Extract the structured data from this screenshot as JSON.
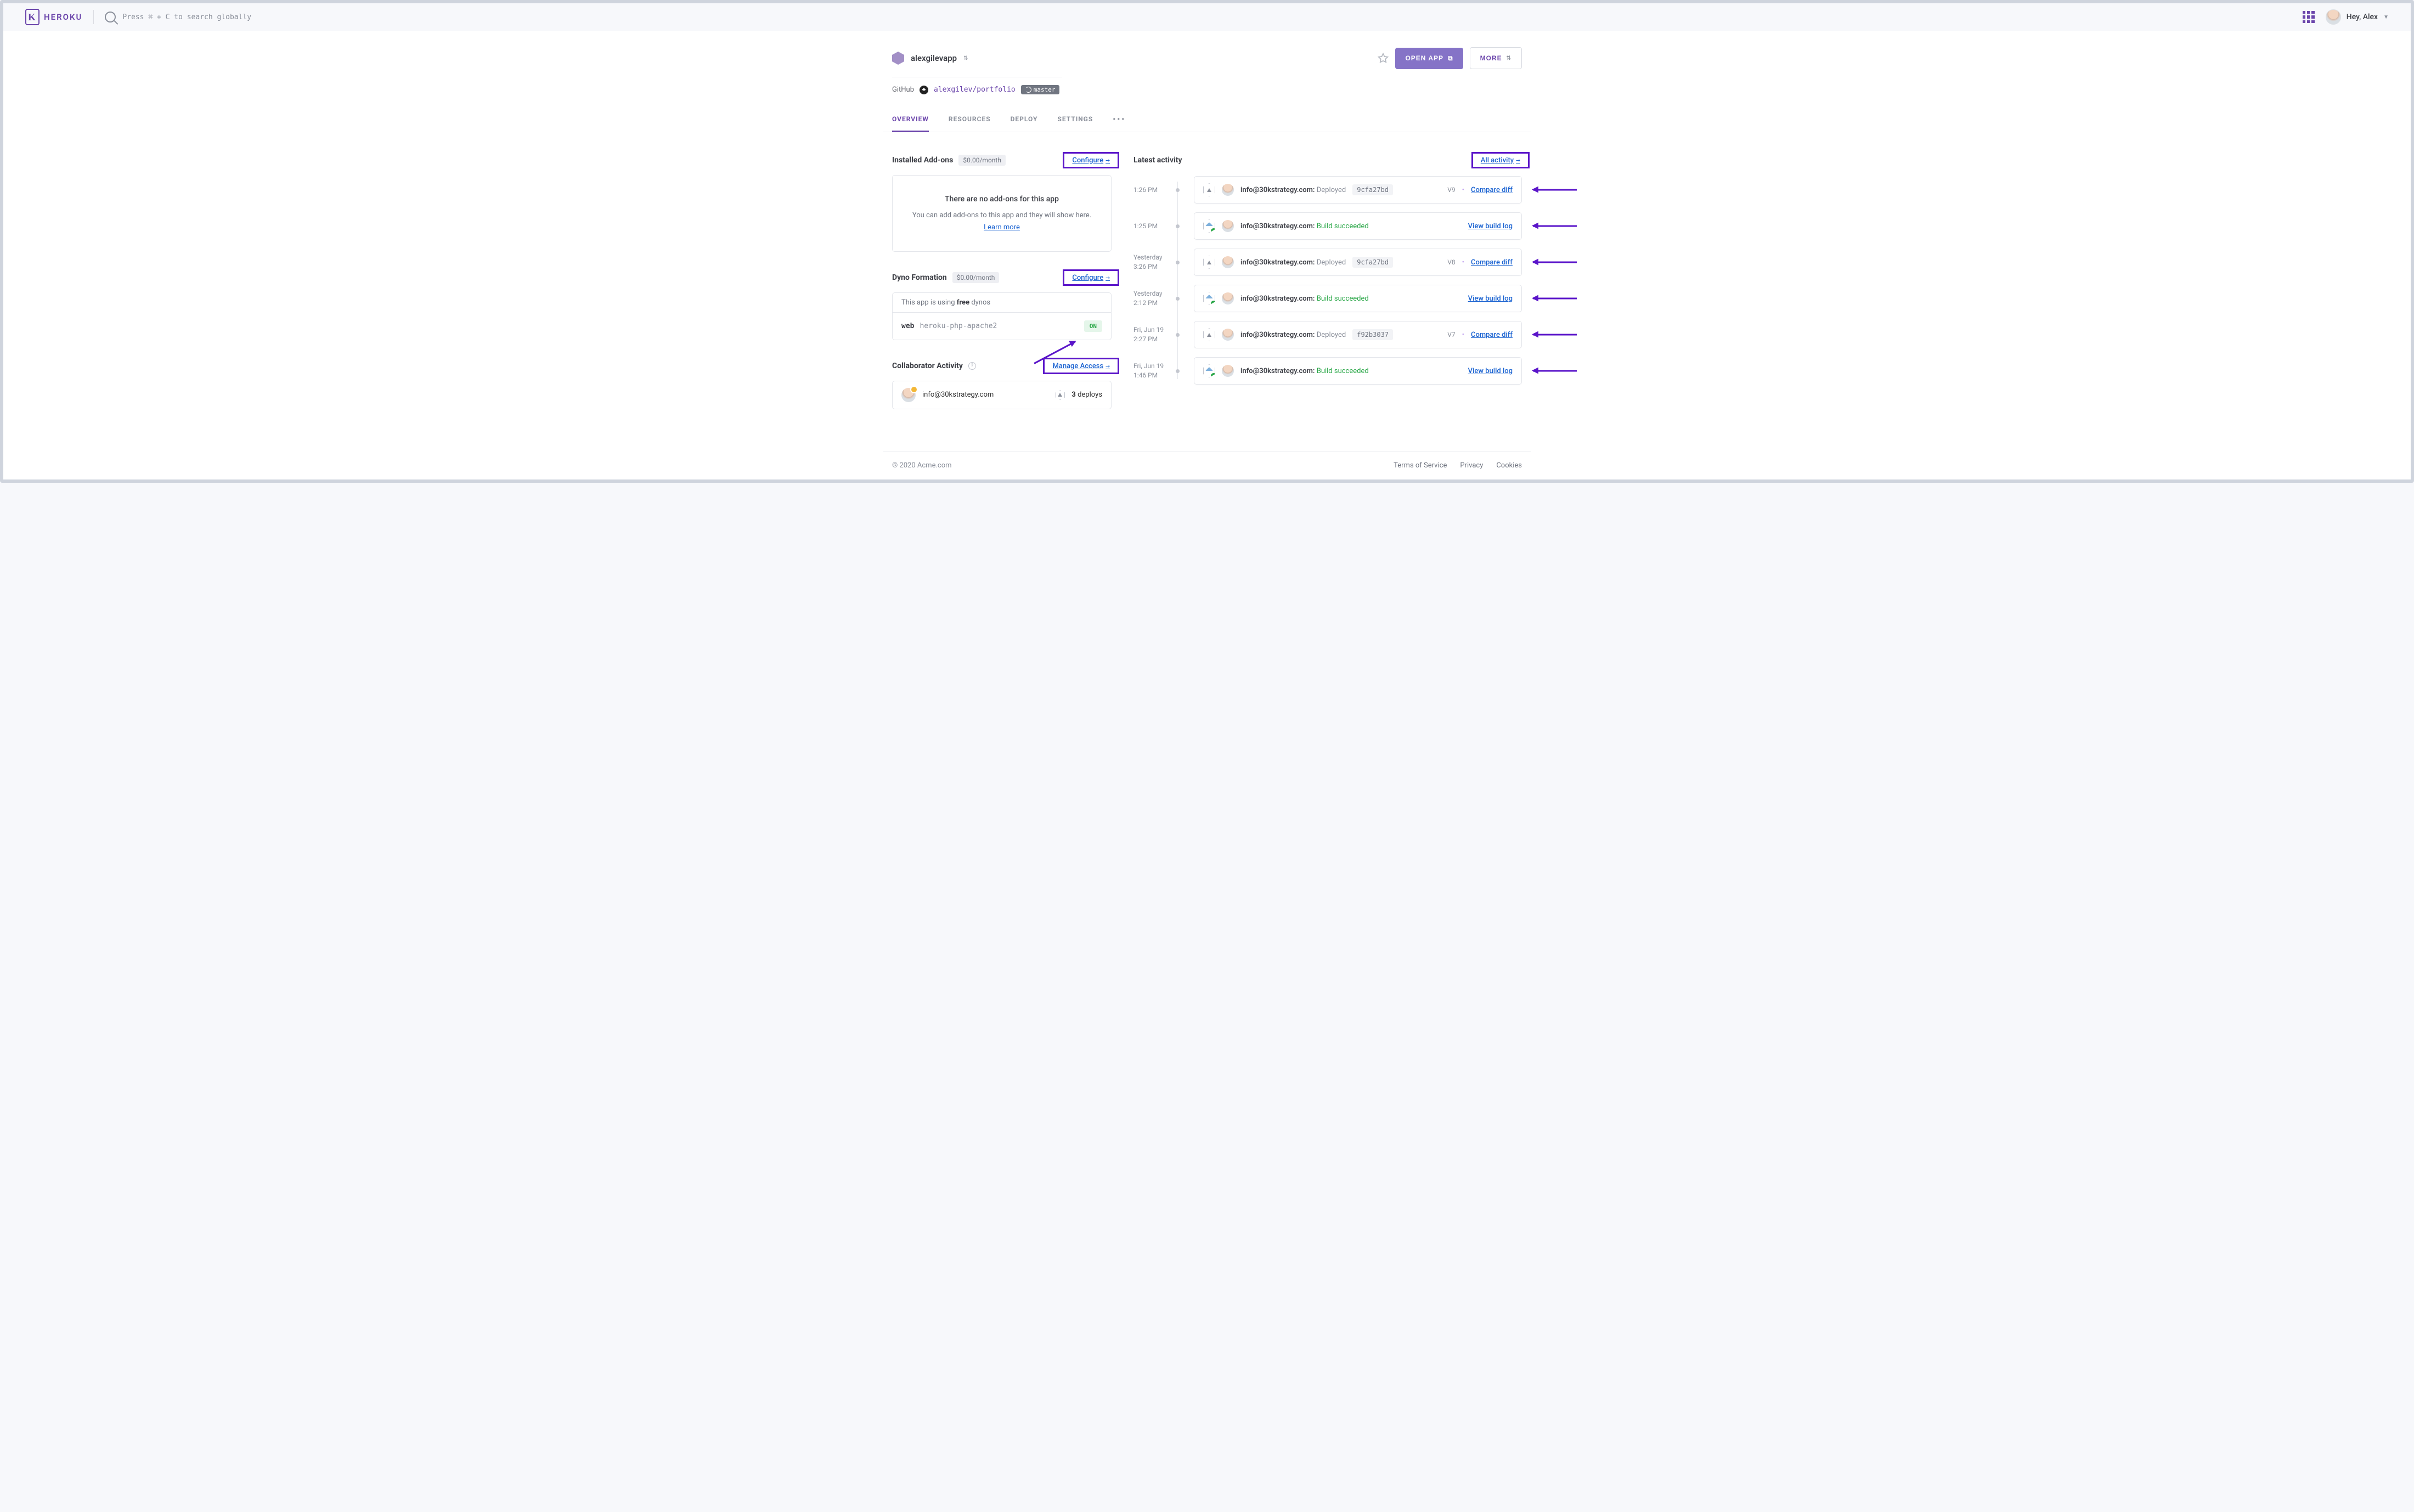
{
  "brand": "HEROKU",
  "search_hint": "Press ⌘ + C to search globally",
  "user_greeting": "Hey, Alex",
  "app": {
    "name": "alexgilevapp",
    "vcs_label": "GitHub",
    "repo": "alexgilev/portfolio",
    "branch": "master"
  },
  "buttons": {
    "open_app": "OPEN APP",
    "more": "MORE"
  },
  "tabs": [
    "OVERVIEW",
    "RESOURCES",
    "DEPLOY",
    "SETTINGS"
  ],
  "addons": {
    "title": "Installed Add-ons",
    "cost": "$0.00/month",
    "configure": "Configure",
    "empty_title": "There are no add-ons for this app",
    "empty_sub": "You can add add-ons to this app and they will show here.",
    "learn_more": "Learn more"
  },
  "dyno": {
    "title": "Dyno Formation",
    "cost": "$0.00/month",
    "configure": "Configure",
    "using_pre": "This app is using ",
    "using_bold": "free",
    "using_post": " dynos",
    "proc_type": "web",
    "proc_cmd": "heroku-php-apache2",
    "status": "ON"
  },
  "collab": {
    "title": "Collaborator Activity",
    "manage": "Manage Access",
    "email": "info@30kstrategy.com",
    "count": "3",
    "count_label": "deploys"
  },
  "latest": {
    "title": "Latest activity",
    "all": "All activity",
    "compare": "Compare diff",
    "viewlog": "View build log",
    "items": [
      {
        "time": "1:26 PM",
        "kind": "deploy",
        "email": "info@30kstrategy.com:",
        "status": "Deployed",
        "hash": "9cfa27bd",
        "ver": "V9"
      },
      {
        "time": "1:25 PM",
        "kind": "build",
        "email": "info@30kstrategy.com:",
        "status": "Build succeeded"
      },
      {
        "time": "Yesterday 3:26 PM",
        "kind": "deploy",
        "email": "info@30kstrategy.com:",
        "status": "Deployed",
        "hash": "9cfa27bd",
        "ver": "V8"
      },
      {
        "time": "Yesterday 2:12 PM",
        "kind": "build",
        "email": "info@30kstrategy.com:",
        "status": "Build succeeded"
      },
      {
        "time": "Fri, Jun 19 2:27 PM",
        "kind": "deploy",
        "email": "info@30kstrategy.com:",
        "status": "Deployed",
        "hash": "f92b3037",
        "ver": "V7"
      },
      {
        "time": "Fri, Jun 19 1:46 PM",
        "kind": "build",
        "email": "info@30kstrategy.com:",
        "status": "Build succeeded"
      }
    ]
  },
  "footer": {
    "copyright": "© 2020 Acme.com",
    "tos": "Terms of Service",
    "privacy": "Privacy",
    "cookies": "Cookies"
  }
}
